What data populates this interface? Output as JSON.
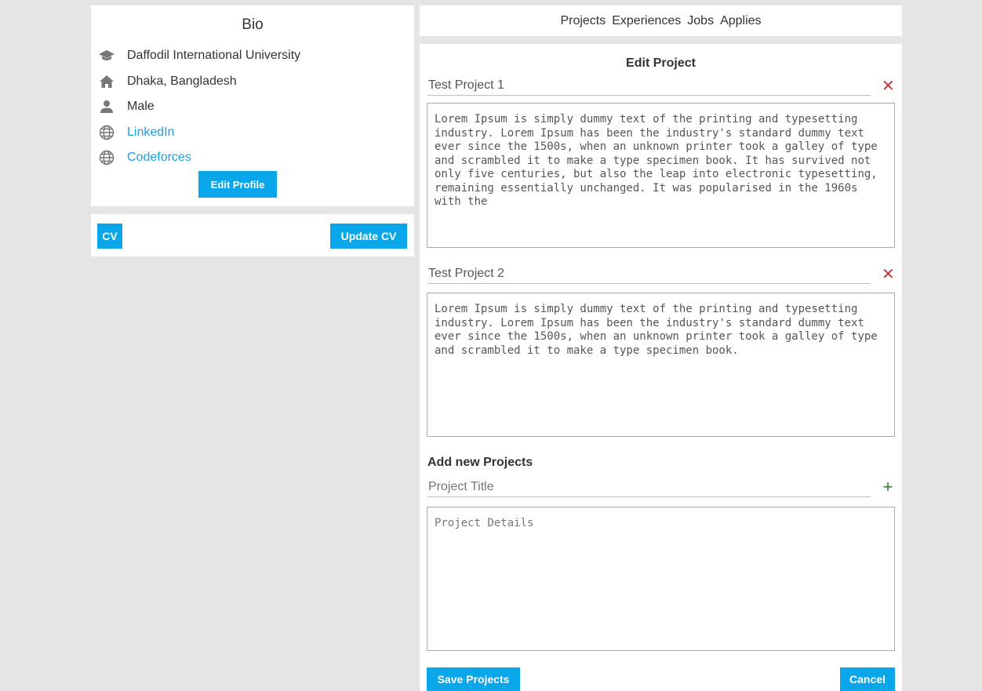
{
  "bio": {
    "title": "Bio",
    "university": "Daffodil International University",
    "location": "Dhaka, Bangladesh",
    "gender": "Male",
    "linkedin_label": "LinkedIn",
    "codeforces_label": "Codeforces",
    "edit_profile_label": "Edit Profile"
  },
  "cv": {
    "cv_label": "CV",
    "update_label": "Update CV"
  },
  "nav": {
    "items": [
      "Projects",
      "Experiences",
      "Jobs",
      "Applies"
    ]
  },
  "edit_project": {
    "heading": "Edit Project",
    "projects": [
      {
        "title": "Test Project 1",
        "details": "Lorem Ipsum is simply dummy text of the printing and typesetting industry. Lorem Ipsum has been the industry's standard dummy text ever since the 1500s, when an unknown printer took a galley of type and scrambled it to make a type specimen book. It has survived not only five centuries, but also the leap into electronic typesetting, remaining essentially unchanged. It was popularised in the 1960s with the"
      },
      {
        "title": "Test Project 2",
        "details": "Lorem Ipsum is simply dummy text of the printing and typesetting industry. Lorem Ipsum has been the industry's standard dummy text ever since the 1500s, when an unknown printer took a galley of type and scrambled it to make a type specimen book."
      }
    ],
    "add_heading": "Add new Projects",
    "new_title_placeholder": "Project Title",
    "new_details_placeholder": "Project Details",
    "save_label": "Save Projects",
    "cancel_label": "Cancel"
  },
  "colors": {
    "accent": "#0aa6ea",
    "link": "#1f9fdb",
    "remove": "#d32f2f",
    "add": "#2e7d32"
  },
  "icons": [
    "graduation-cap-icon",
    "home-icon",
    "person-icon",
    "globe-icon",
    "close-icon",
    "plus-icon"
  ]
}
